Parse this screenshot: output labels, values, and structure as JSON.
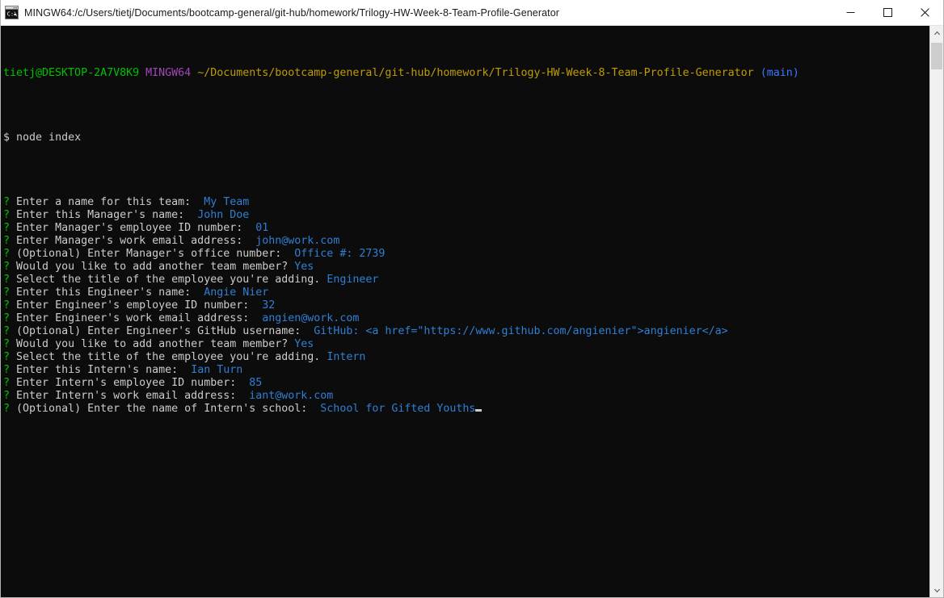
{
  "window": {
    "title": "MINGW64:/c/Users/tietj/Documents/bootcamp-general/git-hub/homework/Trilogy-HW-Week-8-Team-Profile-Generator",
    "icon": "console-icon",
    "controls": {
      "minimize": "—",
      "maximize": "□",
      "close": "✕"
    }
  },
  "theme": {
    "background": "#0c0c0c",
    "foreground": "#cccccc",
    "green": "#00c200",
    "purple": "#a347ba",
    "yellow": "#c19c00",
    "branch_blue": "#3b78ff",
    "answer_blue": "#2f7fd4",
    "titlebar_bg": "#ffffff",
    "scrollbar_bg": "#f0f0f0"
  },
  "terminal": {
    "prompt": {
      "user_host": "tietj@DESKTOP-2A7V8K9",
      "shell": "MINGW64",
      "path": "~/Documents/bootcamp-general/git-hub/homework/Trilogy-HW-Week-8-Team-Profile-Generator",
      "branch": "(main)"
    },
    "command_line": {
      "sigil": "$",
      "command": "node index"
    },
    "prompt_marker": "?",
    "entries": [
      {
        "question": "Enter a name for this team:",
        "answer": "My Team",
        "gap": "  "
      },
      {
        "question": "Enter this Manager's name:",
        "answer": "John Doe",
        "gap": "  "
      },
      {
        "question": "Enter Manager's employee ID number:",
        "answer": "01",
        "gap": "  "
      },
      {
        "question": "Enter Manager's work email address:",
        "answer": "john@work.com",
        "gap": "  "
      },
      {
        "question": "(Optional) Enter Manager's office number:",
        "answer": "Office #: 2739",
        "gap": "  "
      },
      {
        "question": "Would you like to add another team member?",
        "answer": "Yes",
        "gap": " "
      },
      {
        "question": "Select the title of the employee you're adding.",
        "answer": "Engineer",
        "gap": " "
      },
      {
        "question": "Enter this Engineer's name:",
        "answer": "Angie Nier",
        "gap": "  "
      },
      {
        "question": "Enter Engineer's employee ID number:",
        "answer": "32",
        "gap": "  "
      },
      {
        "question": "Enter Engineer's work email address:",
        "answer": "angien@work.com",
        "gap": "  "
      },
      {
        "question": "(Optional) Enter Engineer's GitHub username:",
        "answer": "GitHub: <a href=\"https://www.github.com/angienier\">angienier</a>",
        "gap": "  "
      },
      {
        "question": "Would you like to add another team member?",
        "answer": "Yes",
        "gap": " "
      },
      {
        "question": "Select the title of the employee you're adding.",
        "answer": "Intern",
        "gap": " "
      },
      {
        "question": "Enter this Intern's name:",
        "answer": "Ian Turn",
        "gap": "  "
      },
      {
        "question": "Enter Intern's employee ID number:",
        "answer": "85",
        "gap": "  "
      },
      {
        "question": "Enter Intern's work email address:",
        "answer": "iant@work.com",
        "gap": "  "
      },
      {
        "question": "(Optional) Enter the name of Intern's school:",
        "answer": "School for Gifted Youths",
        "gap": "  ",
        "cursor": true
      }
    ]
  },
  "scrollbar": {
    "up_arrow": "▲",
    "down_arrow": "▼"
  }
}
